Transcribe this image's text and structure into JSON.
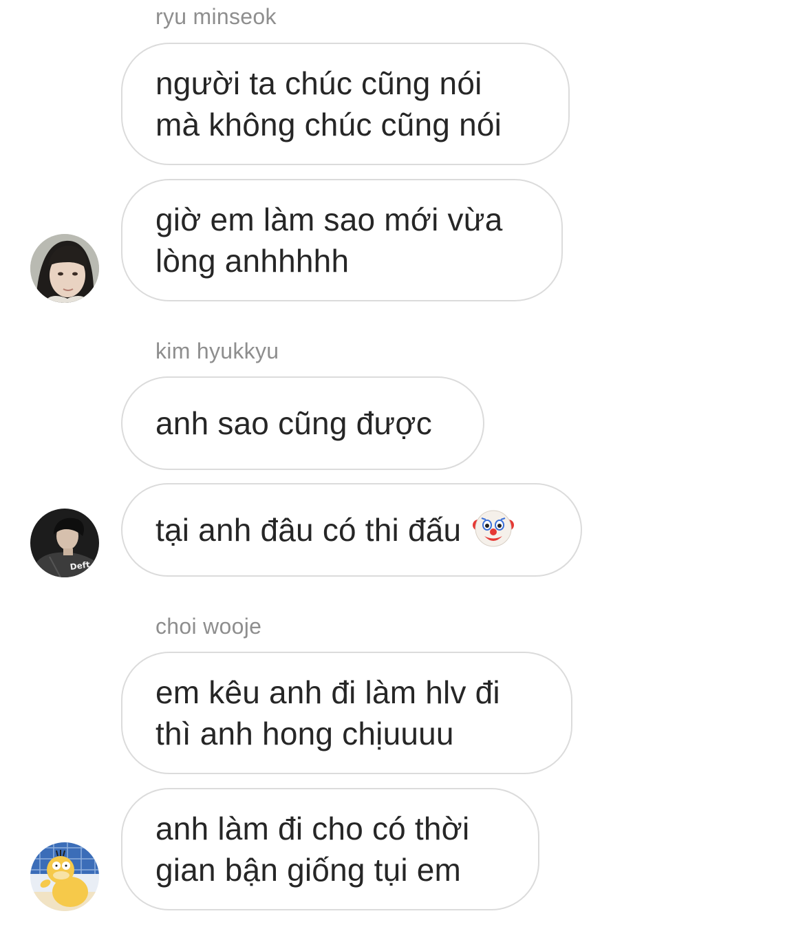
{
  "groups": [
    {
      "sender": "ryu minseok",
      "avatar_icon": "user-avatar-photo",
      "messages": [
        "người ta chúc cũng nói\nmà không chúc cũng nói",
        "giờ em làm sao mới vừa\nlòng anhhhhh"
      ]
    },
    {
      "sender": "kim hyukkyu",
      "avatar_icon": "user-avatar-photo",
      "avatar_text": "Deft",
      "messages": [
        "anh sao cũng được",
        "tại anh đâu có thi đấu"
      ],
      "emoji": "clown-face-icon"
    },
    {
      "sender": "choi wooje",
      "avatar_icon": "psyduck-avatar",
      "messages": [
        "em kêu anh đi làm hlv đi\nthì anh hong chịuuuu",
        "anh làm đi cho có thời\ngian bận giống tụi em"
      ]
    }
  ],
  "colors": {
    "bubble_border": "#dbdbdb",
    "text": "#262626",
    "sender_name": "#8e8e8e"
  }
}
